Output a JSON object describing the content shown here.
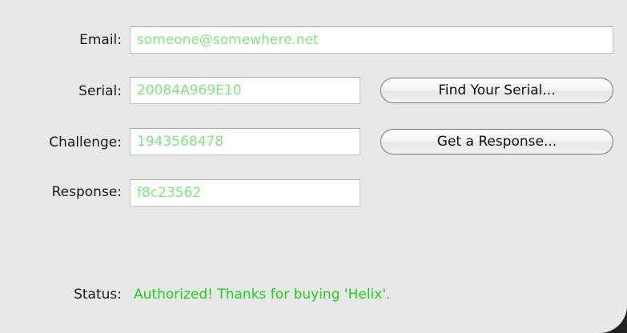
{
  "form": {
    "email": {
      "label": "Email:",
      "value": "someone@somewhere.net"
    },
    "serial": {
      "label": "Serial:",
      "value": "20084A969E10"
    },
    "challenge": {
      "label": "Challenge:",
      "value": "1943568478"
    },
    "response": {
      "label": "Response:",
      "value": "f8c23562"
    }
  },
  "buttons": {
    "find_serial": "Find Your Serial...",
    "get_response": "Get a Response..."
  },
  "status": {
    "label": "Status:",
    "text": "Authorized! Thanks for buying 'Helix'."
  },
  "colors": {
    "field_text": "#80e880",
    "status_text": "#18d318",
    "panel_background": "#e8e8e8"
  },
  "icons": {
    "resize_grip": "resize-grip-icon"
  }
}
